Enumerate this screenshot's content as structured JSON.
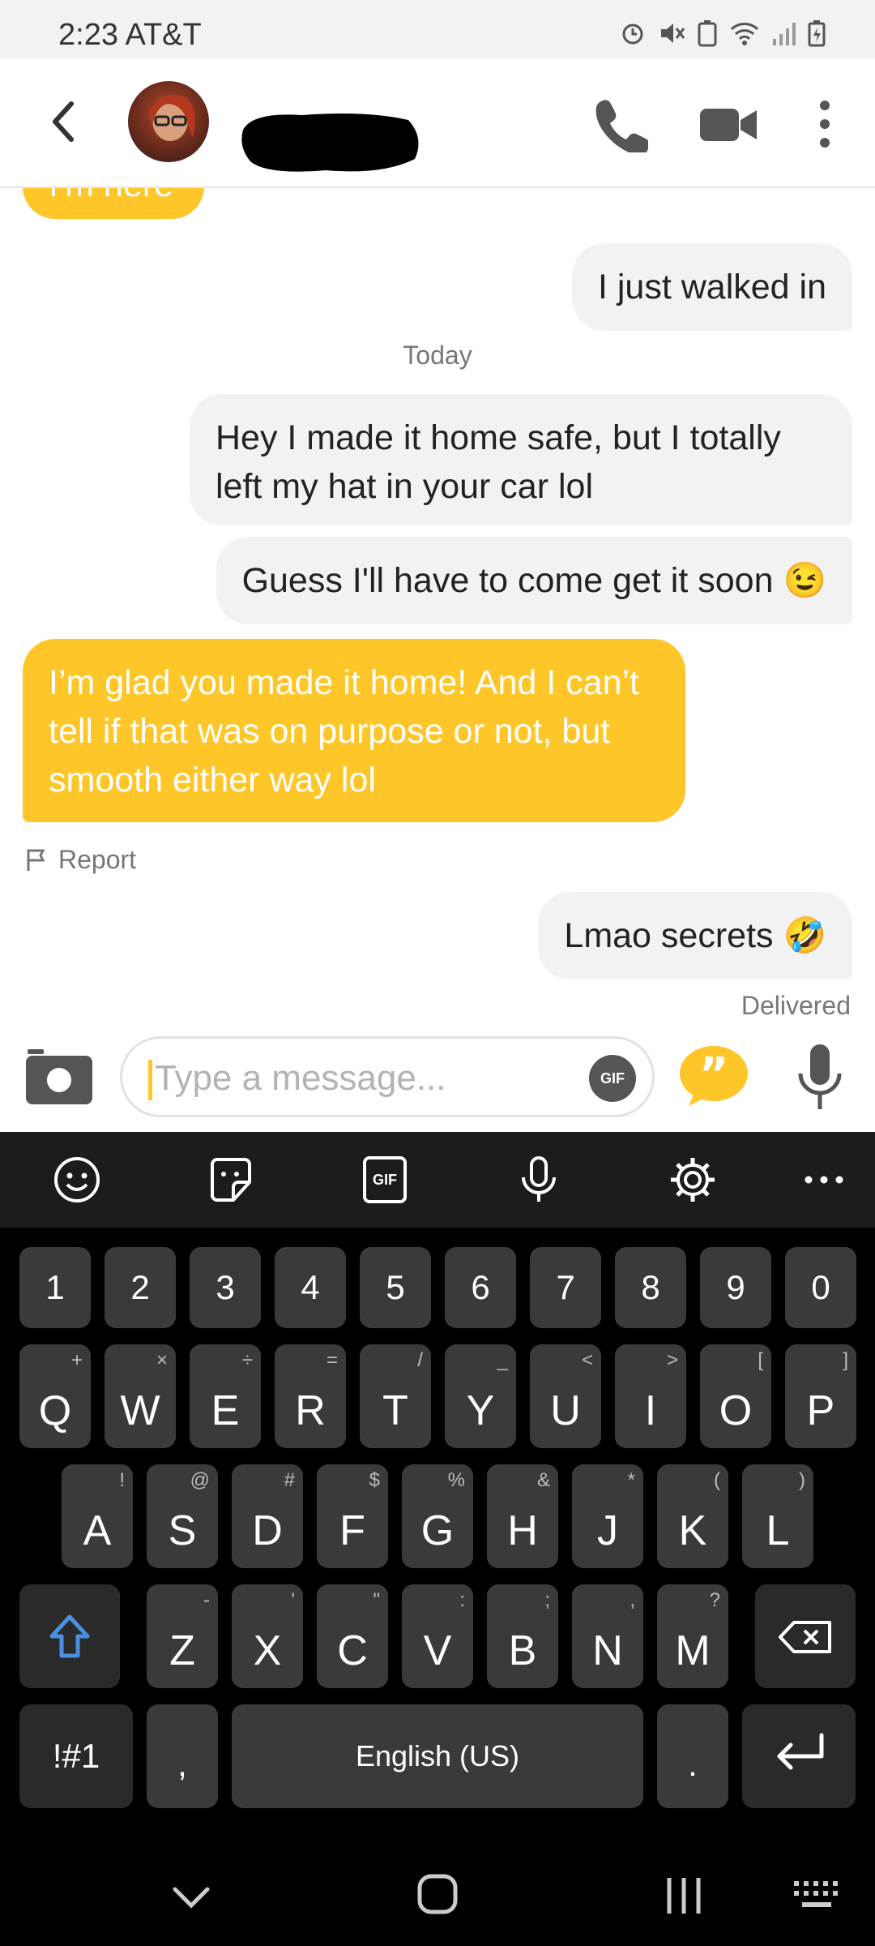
{
  "status_bar": {
    "time": "2:23",
    "carrier": "AT&T"
  },
  "header": {
    "back_icon": "chevron-left-icon",
    "call_icon": "phone-icon",
    "video_icon": "video-camera-icon",
    "menu_icon": "more-vertical-icon"
  },
  "chat": {
    "partial_top": "I'm here",
    "messages": [
      {
        "side": "out",
        "text": "I just walked in"
      },
      {
        "side": "separator",
        "text": "Today"
      },
      {
        "side": "out",
        "text": "Hey I made it home safe, but I totally left my hat in your car lol"
      },
      {
        "side": "out",
        "text": "Guess I'll have to come get it soon 😉"
      },
      {
        "side": "in",
        "text": "I’m glad you made it home! And I can’t tell if that was on purpose or not, but smooth either way lol"
      },
      {
        "side": "out",
        "text": "Lmao secrets 🤣"
      }
    ],
    "report_label": "Report",
    "delivered_label": "Delivered"
  },
  "input": {
    "placeholder": "Type a message...",
    "gif_label": "GIF"
  },
  "keyboard": {
    "toolbar_gif": "GIF",
    "number_row": [
      "1",
      "2",
      "3",
      "4",
      "5",
      "6",
      "7",
      "8",
      "9",
      "0"
    ],
    "row1": [
      {
        "k": "Q",
        "s": "+"
      },
      {
        "k": "W",
        "s": "×"
      },
      {
        "k": "E",
        "s": "÷"
      },
      {
        "k": "R",
        "s": "="
      },
      {
        "k": "T",
        "s": "/"
      },
      {
        "k": "Y",
        "s": "_"
      },
      {
        "k": "U",
        "s": "<"
      },
      {
        "k": "I",
        "s": ">"
      },
      {
        "k": "O",
        "s": "["
      },
      {
        "k": "P",
        "s": "]"
      }
    ],
    "row2": [
      {
        "k": "A",
        "s": "!"
      },
      {
        "k": "S",
        "s": "@"
      },
      {
        "k": "D",
        "s": "#"
      },
      {
        "k": "F",
        "s": "$"
      },
      {
        "k": "G",
        "s": "%"
      },
      {
        "k": "H",
        "s": "&"
      },
      {
        "k": "J",
        "s": "*"
      },
      {
        "k": "K",
        "s": "("
      },
      {
        "k": "L",
        "s": ")"
      }
    ],
    "row3": [
      {
        "k": "Z",
        "s": "-"
      },
      {
        "k": "X",
        "s": "'"
      },
      {
        "k": "C",
        "s": "\""
      },
      {
        "k": "V",
        "s": ":"
      },
      {
        "k": "B",
        "s": ";"
      },
      {
        "k": "N",
        "s": ","
      },
      {
        "k": "M",
        "s": "?"
      }
    ],
    "symbols_label": "!#1",
    "comma_label": ",",
    "space_label": "English (US)",
    "period_label": "."
  },
  "colors": {
    "accent": "#ffc629",
    "shift_blue": "#4a90e2"
  }
}
